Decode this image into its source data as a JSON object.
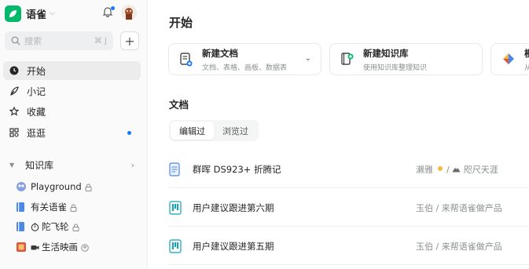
{
  "sidebar": {
    "brand": "语雀",
    "search": {
      "placeholder": "搜索",
      "shortcut": "⌘ J"
    },
    "nav": [
      {
        "label": "开始",
        "icon": "clock-icon",
        "active": true
      },
      {
        "label": "小记",
        "icon": "feather-icon"
      },
      {
        "label": "收藏",
        "icon": "star-icon"
      },
      {
        "label": "逛逛",
        "icon": "grid-icon"
      }
    ],
    "library_section": "知识库",
    "books": [
      {
        "label": "Playground",
        "icon": "playground-book-icon"
      },
      {
        "label": "有关语雀",
        "icon": "book-icon"
      },
      {
        "label": "陀飞轮",
        "icon": "book-icon",
        "emoji": "stopwatch-emoji"
      },
      {
        "label": "生活映画",
        "icon": "photo-book-icon",
        "emoji": "camera-emoji"
      }
    ]
  },
  "main": {
    "title": "开始",
    "cards": [
      {
        "title": "新建文档",
        "subtitle": "文档、表格、画板、数据表"
      },
      {
        "title": "新建知识库",
        "subtitle": "使用知识库整理知识"
      },
      {
        "title": "模",
        "subtitle": "从"
      }
    ],
    "docs_title": "文档",
    "tabs": [
      "编辑过",
      "浏览过"
    ],
    "docs": [
      {
        "title": "群晖 DS923+ 折腾记",
        "author": "濑雅",
        "separator": " / ",
        "book": "咫尺天涯",
        "icon": "doc-icon"
      },
      {
        "title": "用户建议跟进第六期",
        "meta": "玉伯 / 来帮语雀做产品",
        "icon": "board-icon"
      },
      {
        "title": "用户建议跟进第五期",
        "meta": "玉伯 / 来帮语雀做产品",
        "icon": "board-icon"
      }
    ]
  },
  "colors": {
    "brand": "#00b96b",
    "accent": "#1677ff"
  }
}
